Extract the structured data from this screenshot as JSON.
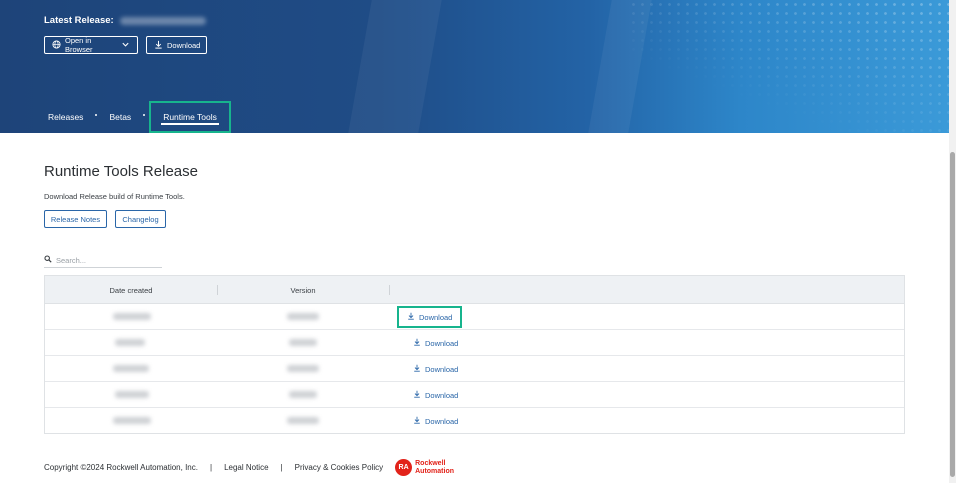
{
  "hero": {
    "latest_label": "Latest Release:",
    "open_in_browser": "Open in Browser",
    "download": "Download"
  },
  "nav": {
    "tabs": [
      {
        "label": "Releases"
      },
      {
        "label": "Betas"
      },
      {
        "label": "Runtime Tools",
        "active": true
      }
    ]
  },
  "main": {
    "title": "Runtime Tools Release",
    "subtitle": "Download Release build of Runtime Tools.",
    "release_notes": "Release Notes",
    "changelog": "Changelog",
    "search_placeholder": "Search..."
  },
  "table": {
    "headers": [
      "Date created",
      "Version"
    ],
    "download_label": "Download",
    "rows": [
      {
        "highlighted": true
      },
      {
        "highlighted": false
      },
      {
        "highlighted": false
      },
      {
        "highlighted": false
      },
      {
        "highlighted": false
      }
    ]
  },
  "footer": {
    "copyright": "Copyright ©2024 Rockwell Automation, Inc.",
    "legal": "Legal Notice",
    "privacy": "Privacy & Cookies Policy",
    "separator": "|",
    "logo_mark": "RA",
    "logo_line1": "Rockwell",
    "logo_line2": "Automation"
  },
  "colors": {
    "accent": "#2a66a8",
    "highlight": "#17b48d",
    "brand_red": "#e2231a"
  },
  "icons": [
    "globe-icon",
    "chevron-down-icon",
    "download-icon",
    "search-icon"
  ]
}
